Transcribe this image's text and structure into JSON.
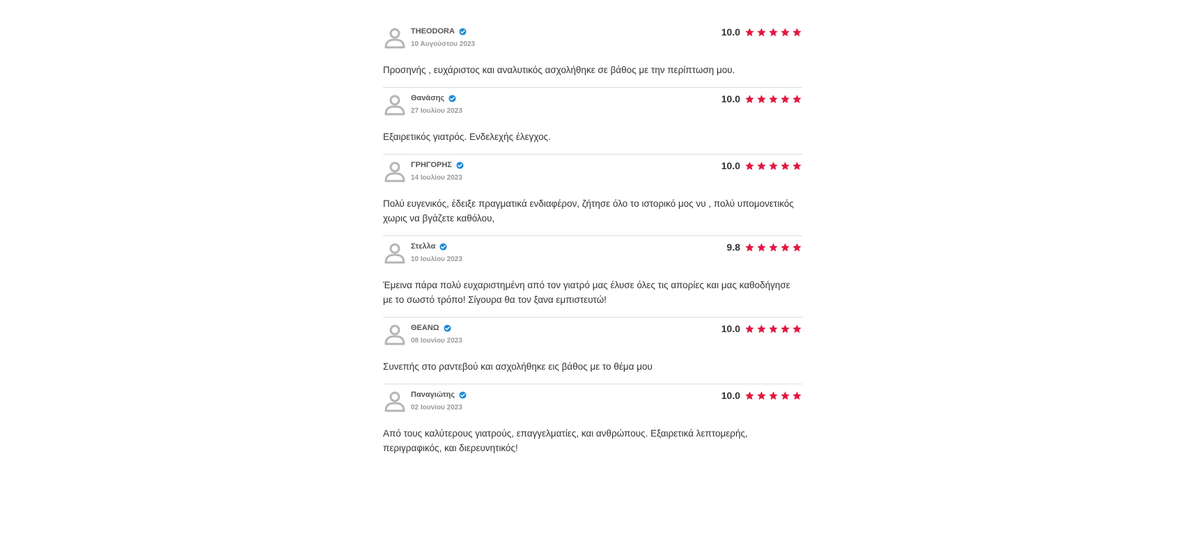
{
  "colors": {
    "star": "#e3163f",
    "verified": "#1e8bd6",
    "avatar": "#b5b5b5",
    "divider": "#dcdcdc"
  },
  "icons": {
    "avatar": "user-avatar-icon",
    "verified": "verified-check-icon",
    "star": "star-icon"
  },
  "reviews": [
    {
      "author": "THEODORA",
      "date": "10 Αυγούστου 2023",
      "score": "10.0",
      "stars": 5,
      "text": "Προσηνής , ευχάριστος και αναλυτικός ασχολήθηκε σε βάθος με την περίπτωση μου."
    },
    {
      "author": "Θανάσης",
      "date": "27 Ιουλίου 2023",
      "score": "10.0",
      "stars": 5,
      "text": "Εξαιρετικός γιατρός. Ενδελεχής έλεγχος."
    },
    {
      "author": "ΓΡΗΓΟΡΗΣ",
      "date": "14 Ιουλίου 2023",
      "score": "10.0",
      "stars": 5,
      "text": "Πολύ ευγενικός, έδειξε πραγματικά ενδιαφέρον, ζήτησε όλο το ιστορικό μος νυ , πολύ υπομονετικός χωρις να βγάζετε καθόλου,"
    },
    {
      "author": "Στελλα",
      "date": "10 Ιουλίου 2023",
      "score": "9.8",
      "stars": 5,
      "text": "Έμεινα πάρα πολύ ευχαριστημένη από τον γιατρό μας έλυσε όλες τις απορίες και μας καθοδήγησε με το σωστό τρόπο! Σίγουρα θα τον ξανα εμπιστευτώ!"
    },
    {
      "author": "ΘΕΑΝΩ",
      "date": "08 Ιουνίου 2023",
      "score": "10.0",
      "stars": 5,
      "text": "Συνεπής στο ραντεβού και ασχολήθηκε εις βάθος με το θέμα μου"
    },
    {
      "author": "Παναγιώτης",
      "date": "02 Ιουνίου 2023",
      "score": "10.0",
      "stars": 5,
      "text": "Από τους καλύτερους γιατρούς, επαγγελματίες, και ανθρώπους. Εξαιρετικά λεπτομερής, περιγραφικός, και διερευνητικός!"
    }
  ]
}
